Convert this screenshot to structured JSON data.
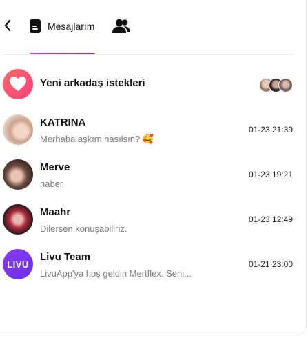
{
  "header": {
    "messages_tab": "Mesajlarım"
  },
  "friend_requests": {
    "title": "Yeni arkadaş istekleri"
  },
  "conversations": [
    {
      "name": "KATRINA",
      "preview": "Merhaba aşkım nasılsın? 🥰",
      "time": "01-23 21:39"
    },
    {
      "name": "Merve",
      "preview": "naber",
      "time": "01-23 19:21"
    },
    {
      "name": "Maahr",
      "preview": "Dilersen konuşabiliriz.",
      "time": "01-23 12:49"
    },
    {
      "name": "Livu Team",
      "preview": "LivuApp'ya hoş geldin Mertflex. Seni...",
      "time": "01-21 23:00"
    }
  ],
  "livu_logo_text": "LIVU",
  "colors": {
    "accent_start": "#c23cf0",
    "accent_end": "#5a2ef2",
    "heart_gradient_start": "#ff6a6a",
    "heart_gradient_end": "#ff3f7c",
    "livu_logo_bg": "#7b2ff2"
  }
}
